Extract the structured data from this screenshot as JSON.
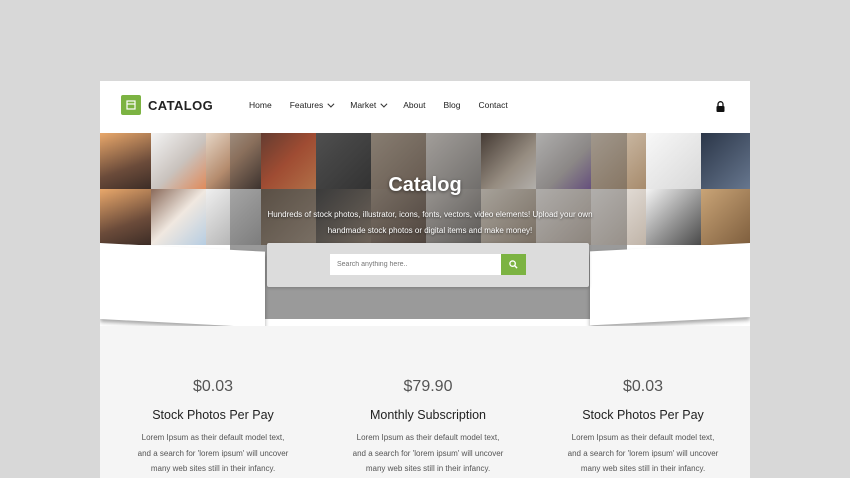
{
  "brand": {
    "name": "CATALOG",
    "accent": "#7cb342"
  },
  "nav": {
    "items": [
      {
        "label": "Home",
        "dropdown": false
      },
      {
        "label": "Features",
        "dropdown": true
      },
      {
        "label": "Market",
        "dropdown": true
      },
      {
        "label": "About",
        "dropdown": false
      },
      {
        "label": "Blog",
        "dropdown": false
      },
      {
        "label": "Contact",
        "dropdown": false
      }
    ],
    "icon": "lock-icon"
  },
  "hero": {
    "title": "Catalog",
    "subtitle": "Hundreds of stock photos, illustrator, icons, fonts, vectors, video elements! Upload your own handmade stock photos or digital items and make money!"
  },
  "search": {
    "placeholder": "Search anything here..",
    "button_icon": "search-icon"
  },
  "pricing": [
    {
      "price": "$0.03",
      "name": "Stock Photos Per Pay",
      "desc": [
        "Lorem Ipsum as their default model text,",
        "and a search for 'lorem ipsum' will uncover",
        "many web sites still in their infancy."
      ]
    },
    {
      "price": "$79.90",
      "name": "Monthly Subscription",
      "desc": [
        "Lorem Ipsum as their default model text,",
        "and a search for 'lorem ipsum' will uncover",
        "many web sites still in their infancy."
      ]
    },
    {
      "price": "$0.03",
      "name": "Stock Photos Per Pay",
      "desc": [
        "Lorem Ipsum as their default model text,",
        "and a search for 'lorem ipsum' will uncover",
        "many web sites still in their infancy."
      ]
    }
  ]
}
